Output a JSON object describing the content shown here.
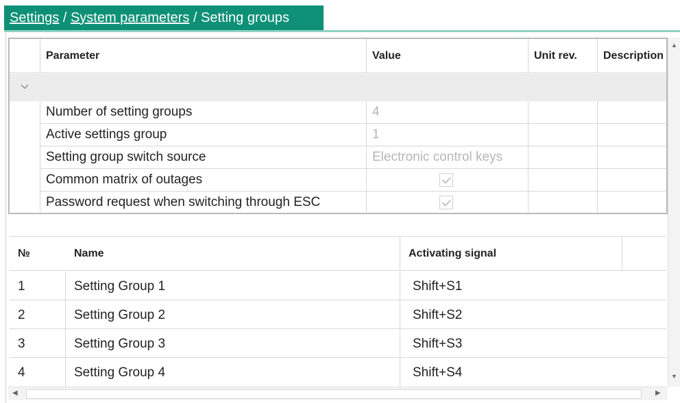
{
  "breadcrumb": {
    "items": [
      "Settings",
      "System parameters",
      "Setting groups"
    ],
    "separator": " / "
  },
  "params": {
    "headers": [
      "Parameter",
      "Value",
      "Unit rev.",
      "Description"
    ],
    "rows": [
      {
        "name": "Number of setting groups",
        "value": "4"
      },
      {
        "name": "Active settings group",
        "value": "1"
      },
      {
        "name": "Setting group switch source",
        "value": "Electronic control keys"
      },
      {
        "name": "Common  matrix of outages",
        "value": "",
        "checked": true
      },
      {
        "name": "Password request when switching through ESC",
        "value": "",
        "checked": true
      }
    ]
  },
  "groups": {
    "headers": [
      "№",
      "Name",
      "Activating signal"
    ],
    "rows": [
      {
        "num": "1",
        "name": "Setting Group 1",
        "signal": "Shift+S1"
      },
      {
        "num": "2",
        "name": "Setting Group 2",
        "signal": "Shift+S2"
      },
      {
        "num": "3",
        "name": "Setting Group 3",
        "signal": "Shift+S3"
      },
      {
        "num": "4",
        "name": "Setting Group 4",
        "signal": "Shift+S4"
      }
    ]
  },
  "colors": {
    "accent": "#0d9076",
    "accent_light": "#8fd2c2"
  },
  "icons": {
    "expand": "chevron-down-icon",
    "scroll_up": "scroll-up-icon",
    "scroll_down": "scroll-down-icon",
    "scroll_left": "scroll-left-icon",
    "scroll_right": "scroll-right-icon"
  }
}
